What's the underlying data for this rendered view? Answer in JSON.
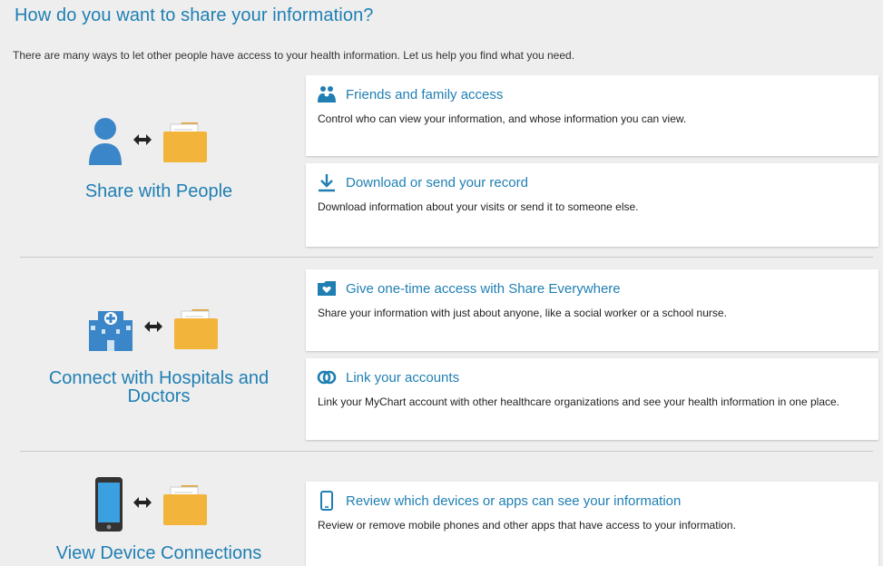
{
  "header": {
    "title": "How do you want to share your information?",
    "intro": "There are many ways to let other people have access to your health information. Let us help you find what you need."
  },
  "sections": [
    {
      "label": "Share with People",
      "cards": [
        {
          "icon": "people-icon",
          "title": "Friends and family access",
          "description": "Control who can view your information, and whose information you can view."
        },
        {
          "icon": "download-icon",
          "title": "Download or send your record",
          "description": "Download information about your visits or send it to someone else."
        }
      ]
    },
    {
      "label": "Connect with Hospitals and Doctors",
      "cards": [
        {
          "icon": "folder-heart-icon",
          "title": "Give one-time access with Share Everywhere",
          "description": "Share your information with just about anyone, like a social worker or a school nurse."
        },
        {
          "icon": "link-icon",
          "title": "Link your accounts",
          "description": "Link your MyChart account with other healthcare organizations and see your health information in one place."
        }
      ]
    },
    {
      "label": "View Device Connections",
      "cards": [
        {
          "icon": "mobile-icon",
          "title": "Review which devices or apps can see your information",
          "description": "Review or remove mobile phones and other apps that have access to your information."
        }
      ]
    }
  ],
  "colors": {
    "accent": "#1f7fb3",
    "folder": "#f3b43b",
    "background": "#eeeeee"
  }
}
